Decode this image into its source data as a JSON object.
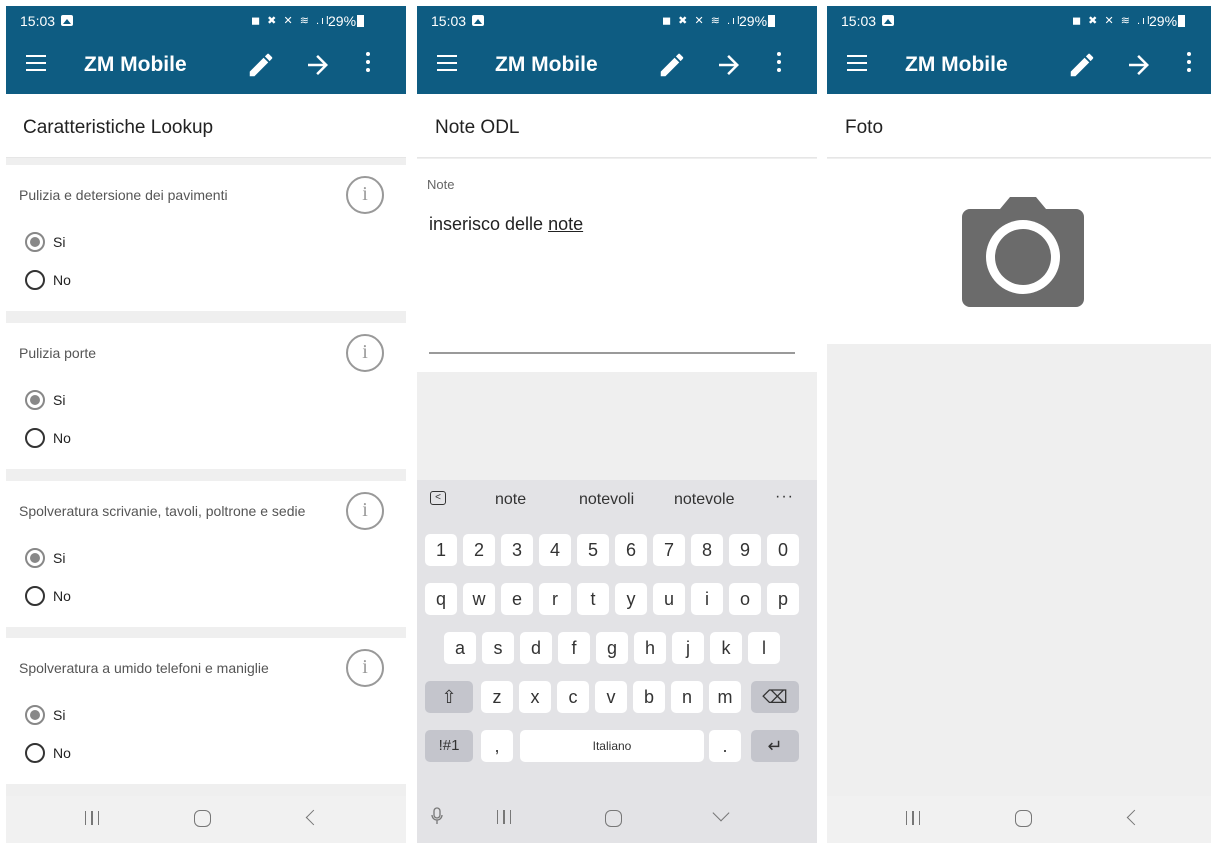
{
  "status": {
    "time": "15:03",
    "battery": "29%",
    "indicators": "◼ ✖ ✕ ≋ .ıl"
  },
  "app": {
    "title": "ZM Mobile"
  },
  "icons": {
    "menu": "menu-icon",
    "edit": "pencil-icon",
    "next": "arrow-right-icon",
    "more": "more-vert-icon",
    "info": "info-icon",
    "camera": "camera-icon",
    "mic": "microphone-icon"
  },
  "screen1": {
    "title": "Caratteristiche Lookup",
    "questions": [
      {
        "label": "Pulizia e detersione dei pavimenti",
        "selected": "Si"
      },
      {
        "label": "Pulizia porte",
        "selected": "Si"
      },
      {
        "label": "Spolveratura scrivanie, tavoli, poltrone e sedie",
        "selected": "Si"
      },
      {
        "label": "Spolveratura a umido telefoni e maniglie",
        "selected": "Si"
      }
    ],
    "option_yes": "Si",
    "option_no": "No",
    "info_glyph": "i"
  },
  "screen2": {
    "title": "Note ODL",
    "field_label": "Note",
    "field_value_plain": "inserisco delle ",
    "field_value_underlined": "note",
    "suggestions": [
      "note",
      "notevoli",
      "notevole"
    ],
    "more_suggestions": "···",
    "keyboard": {
      "row_numbers": [
        "1",
        "2",
        "3",
        "4",
        "5",
        "6",
        "7",
        "8",
        "9",
        "0"
      ],
      "row1": [
        "q",
        "w",
        "e",
        "r",
        "t",
        "y",
        "u",
        "i",
        "o",
        "p"
      ],
      "row2": [
        "a",
        "s",
        "d",
        "f",
        "g",
        "h",
        "j",
        "k",
        "l"
      ],
      "row3": [
        "z",
        "x",
        "c",
        "v",
        "b",
        "n",
        "m"
      ],
      "shift": "⇧",
      "backspace": "⌫",
      "symbols": "!#1",
      "comma": ",",
      "space": "Italiano",
      "period": ".",
      "enter": "↵"
    }
  },
  "screen3": {
    "title": "Foto"
  },
  "colors": {
    "appbar": "#0e5c82",
    "background": "#efefef",
    "camera": "#6b6b6b"
  }
}
